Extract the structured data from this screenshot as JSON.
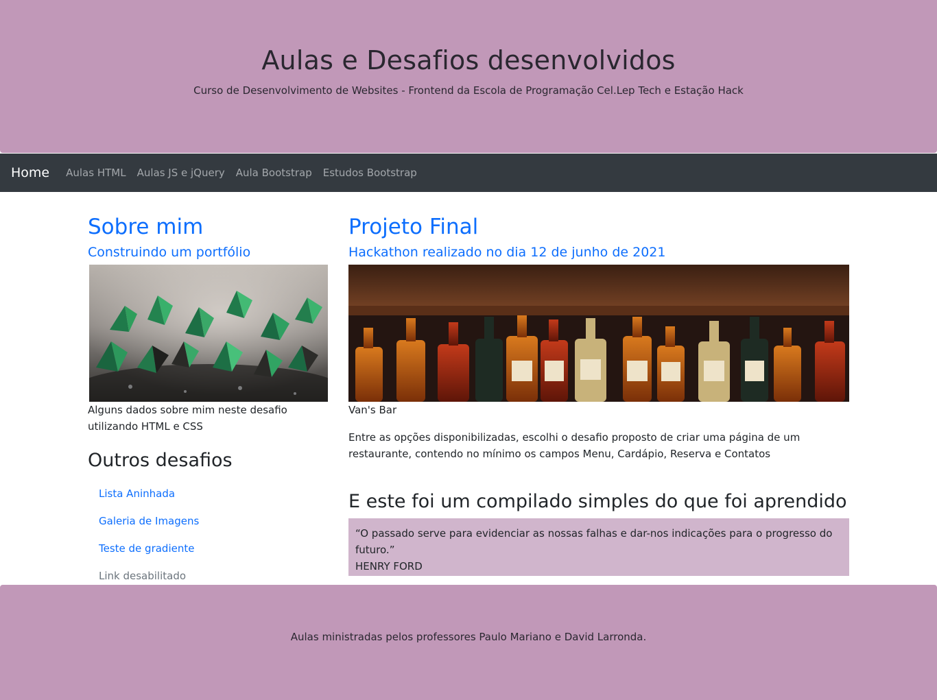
{
  "header": {
    "title": "Aulas e Desafios desenvolvidos",
    "subtitle": "Curso de Desenvolvimento de Websites - Frontend da Escola de Programação Cel.Lep Tech e Estação Hack"
  },
  "navbar": {
    "brand": "Home",
    "links": [
      "Aulas HTML",
      "Aulas JS e jQuery",
      "Aula Bootstrap",
      "Estudos Bootstrap"
    ]
  },
  "left": {
    "title": "Sobre mim",
    "subtitle": "Construindo um portfólio",
    "caption": "Alguns dados sobre mim neste desafio utilizando HTML e CSS",
    "others_title": "Outros desafios",
    "others": [
      {
        "label": "Lista Aninhada",
        "enabled": true
      },
      {
        "label": "Galeria de Imagens",
        "enabled": true
      },
      {
        "label": "Teste de gradiente",
        "enabled": true
      },
      {
        "label": "Link desabilitado",
        "enabled": false
      }
    ]
  },
  "right": {
    "title": "Projeto Final",
    "subtitle": "Hackathon realizado no dia 12 de junho de 2021",
    "caption": "Van's Bar",
    "description": "Entre as opções disponibilizadas, escolhi o desafio proposto de criar uma página de um restaurante, contendo no mínimo os campos Menu, Cardápio, Reserva e Contatos",
    "compilado_title": "E este foi um compilado simples do que foi aprendido",
    "quote": "“O passado serve para evidenciar as nossas falhas e dar-nos indicações para o progresso do futuro.”",
    "quote_author": "HENRY FORD"
  },
  "footer": {
    "text": "Aulas ministradas pelos professores Paulo Mariano e David Larronda."
  },
  "colors": {
    "jumbotron": "#c198b8",
    "navbar": "#343a40",
    "link": "#0d6efd",
    "quote_bg": "#d0b5cc"
  }
}
